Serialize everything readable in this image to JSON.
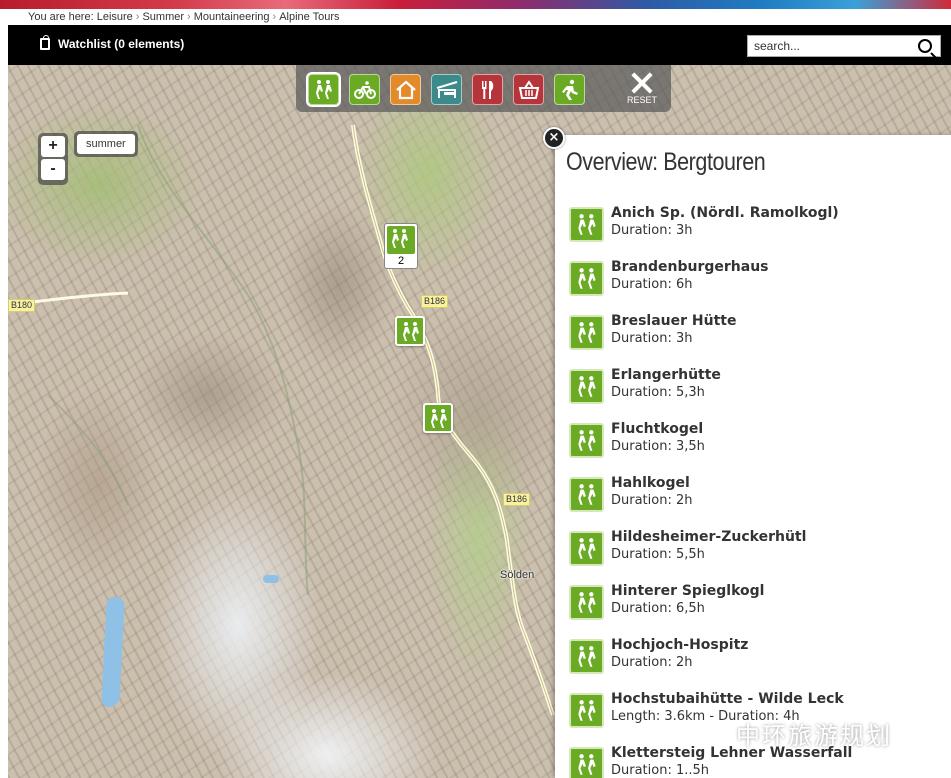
{
  "breadcrumb": {
    "prefix": "You are here:",
    "items": [
      "Leisure",
      "Summer",
      "Mountaineering",
      "Alpine Tours"
    ],
    "separator": "›"
  },
  "header": {
    "watchlist_label": "Watchlist (0 elements)",
    "search_placeholder": "search...",
    "search_value": ""
  },
  "toolbar": {
    "buttons": [
      {
        "icon": "hikers-icon",
        "color": "#6aaa24",
        "active": true
      },
      {
        "icon": "bicycle-icon",
        "color": "#6aaa24",
        "active": false
      },
      {
        "icon": "house-icon",
        "color": "#e38a2a",
        "active": false
      },
      {
        "icon": "bed-icon",
        "color": "#3d8a8a",
        "active": false
      },
      {
        "icon": "fork-knife-icon",
        "color": "#b5353a",
        "active": false
      },
      {
        "icon": "shopping-basket-icon",
        "color": "#b5353a",
        "active": false
      },
      {
        "icon": "runner-icon",
        "color": "#6aaa24",
        "active": false
      }
    ],
    "reset_label": "RESET"
  },
  "map": {
    "zoom_in": "+",
    "zoom_out": "-",
    "season_label": "summer",
    "cluster_count": "2",
    "road_labels": [
      "B180",
      "B186",
      "B186"
    ],
    "town_label": "Sölden"
  },
  "panel": {
    "close_label": "×",
    "title": "Overview: Bergtouren",
    "tours": [
      {
        "name": "Anich Sp. (Nördl. Ramolkogl)",
        "detail": "Duration: 3h"
      },
      {
        "name": "Brandenburgerhaus",
        "detail": "Duration: 6h"
      },
      {
        "name": "Breslauer Hütte",
        "detail": "Duration: 3h"
      },
      {
        "name": "Erlangerhütte",
        "detail": "Duration: 5,3h"
      },
      {
        "name": "Fluchtkogel",
        "detail": "Duration: 3,5h"
      },
      {
        "name": "Hahlkogel",
        "detail": "Duration: 2h"
      },
      {
        "name": "Hildesheimer-Zuckerhütl",
        "detail": "Duration: 5,5h"
      },
      {
        "name": "Hinterer Spieglkogl",
        "detail": "Duration: 6,5h"
      },
      {
        "name": "Hochjoch-Hospitz",
        "detail": "Duration: 2h"
      },
      {
        "name": "Hochstubaihütte - Wilde Leck",
        "detail": "Length: 3.6km - Duration: 4h"
      },
      {
        "name": "Klettersteig Lehner Wasserfall",
        "detail": "Duration: 1..5h"
      }
    ]
  },
  "watermark": {
    "text": "中环旅游规划"
  }
}
